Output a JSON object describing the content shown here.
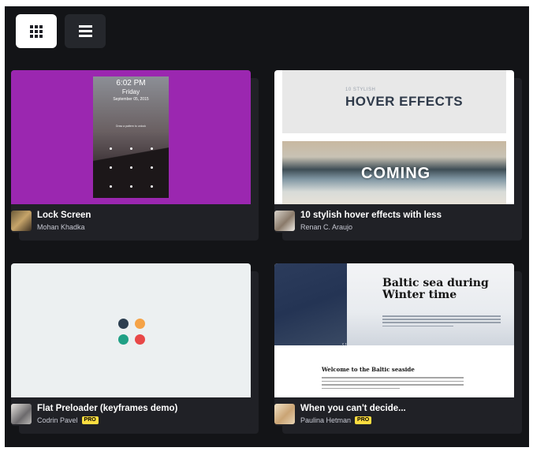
{
  "toolbar": {
    "grid_view_label": "",
    "list_view_label": ""
  },
  "cards": [
    {
      "title": "Lock Screen",
      "author": "Mohan Khadka",
      "pro": "",
      "thumb_color": "#9b27b0",
      "preview": {
        "time": "6:02 PM",
        "day": "Friday",
        "date": "September 05, 2015",
        "hint": "Draw a pattern to unlock"
      }
    },
    {
      "title": "10 stylish hover effects with less",
      "author": "Renan C. Araujo",
      "pro": "",
      "preview": {
        "small": "10 STYLISH",
        "big": "HOVER EFFECTS",
        "coming": "COMING"
      }
    },
    {
      "title": "Flat Preloader (keyframes demo)",
      "author": "Codrin Pavel",
      "pro": "PRO",
      "preview": {
        "dot_colors": [
          "#2c3e50",
          "#f5a347",
          "#1fa085",
          "#e84848"
        ]
      }
    },
    {
      "title": "When you can't decide...",
      "author": "Paulina Hetman",
      "pro": "PRO",
      "preview": {
        "title": "Baltic sea during Winter time",
        "subtitle": "Welcome to the Baltic seaside",
        "arrows": "‹ ›"
      }
    }
  ]
}
